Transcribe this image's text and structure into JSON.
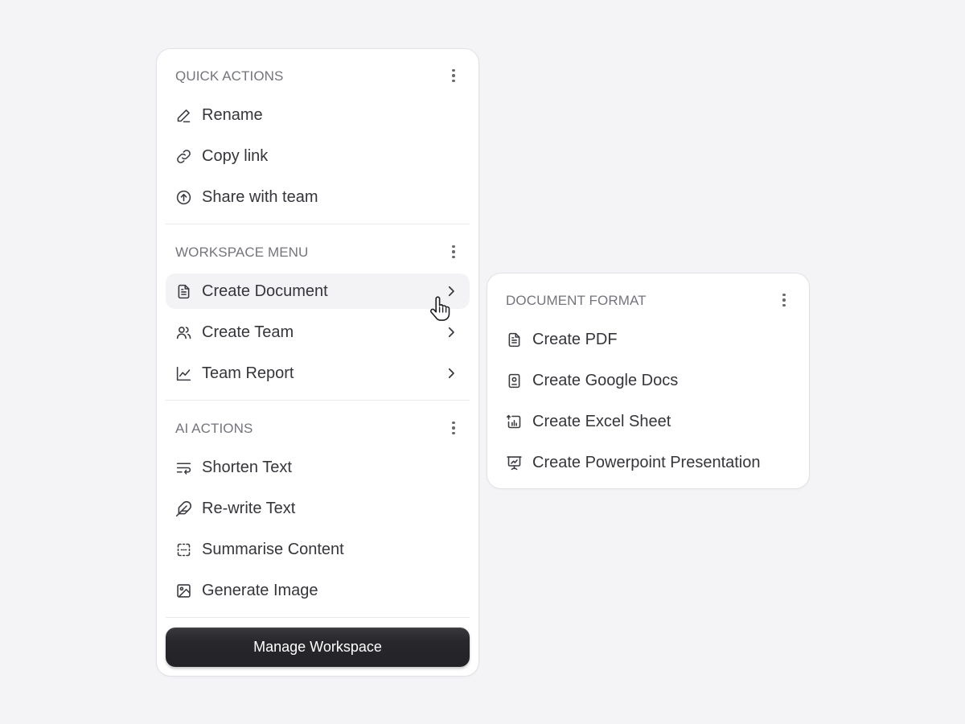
{
  "main_menu": {
    "quick_actions": {
      "title": "QUICK ACTIONS",
      "items": [
        {
          "label": "Rename",
          "icon": "pencil-icon"
        },
        {
          "label": "Copy link",
          "icon": "link-icon"
        },
        {
          "label": "Share with team",
          "icon": "upload-circle-icon"
        }
      ]
    },
    "workspace_menu": {
      "title": "WORKSPACE MENU",
      "items": [
        {
          "label": "Create Document",
          "icon": "document-icon",
          "has_submenu": true,
          "hovered": true
        },
        {
          "label": "Create Team",
          "icon": "users-icon",
          "has_submenu": true
        },
        {
          "label": "Team Report",
          "icon": "line-chart-icon",
          "has_submenu": true
        }
      ]
    },
    "ai_actions": {
      "title": "AI ACTIONS",
      "items": [
        {
          "label": "Shorten Text",
          "icon": "wrap-text-icon"
        },
        {
          "label": "Re-write Text",
          "icon": "feather-icon"
        },
        {
          "label": "Summarise Content",
          "icon": "dashed-frame-icon"
        },
        {
          "label": "Generate Image",
          "icon": "image-icon"
        }
      ]
    },
    "manage_button": "Manage Workspace"
  },
  "submenu": {
    "title": "DOCUMENT FORMAT",
    "items": [
      {
        "label": "Create PDF",
        "icon": "file-text-icon"
      },
      {
        "label": "Create Google Docs",
        "icon": "file-badge-icon"
      },
      {
        "label": "Create Excel Sheet",
        "icon": "sheet-chart-icon"
      },
      {
        "label": "Create Powerpoint Presentation",
        "icon": "presentation-icon"
      }
    ]
  },
  "colors": {
    "background": "#f4f3f6",
    "menu_bg": "#ffffff",
    "hover_bg": "#f3f2f5",
    "section_title": "#75747c",
    "button_bg": "#28272b"
  }
}
